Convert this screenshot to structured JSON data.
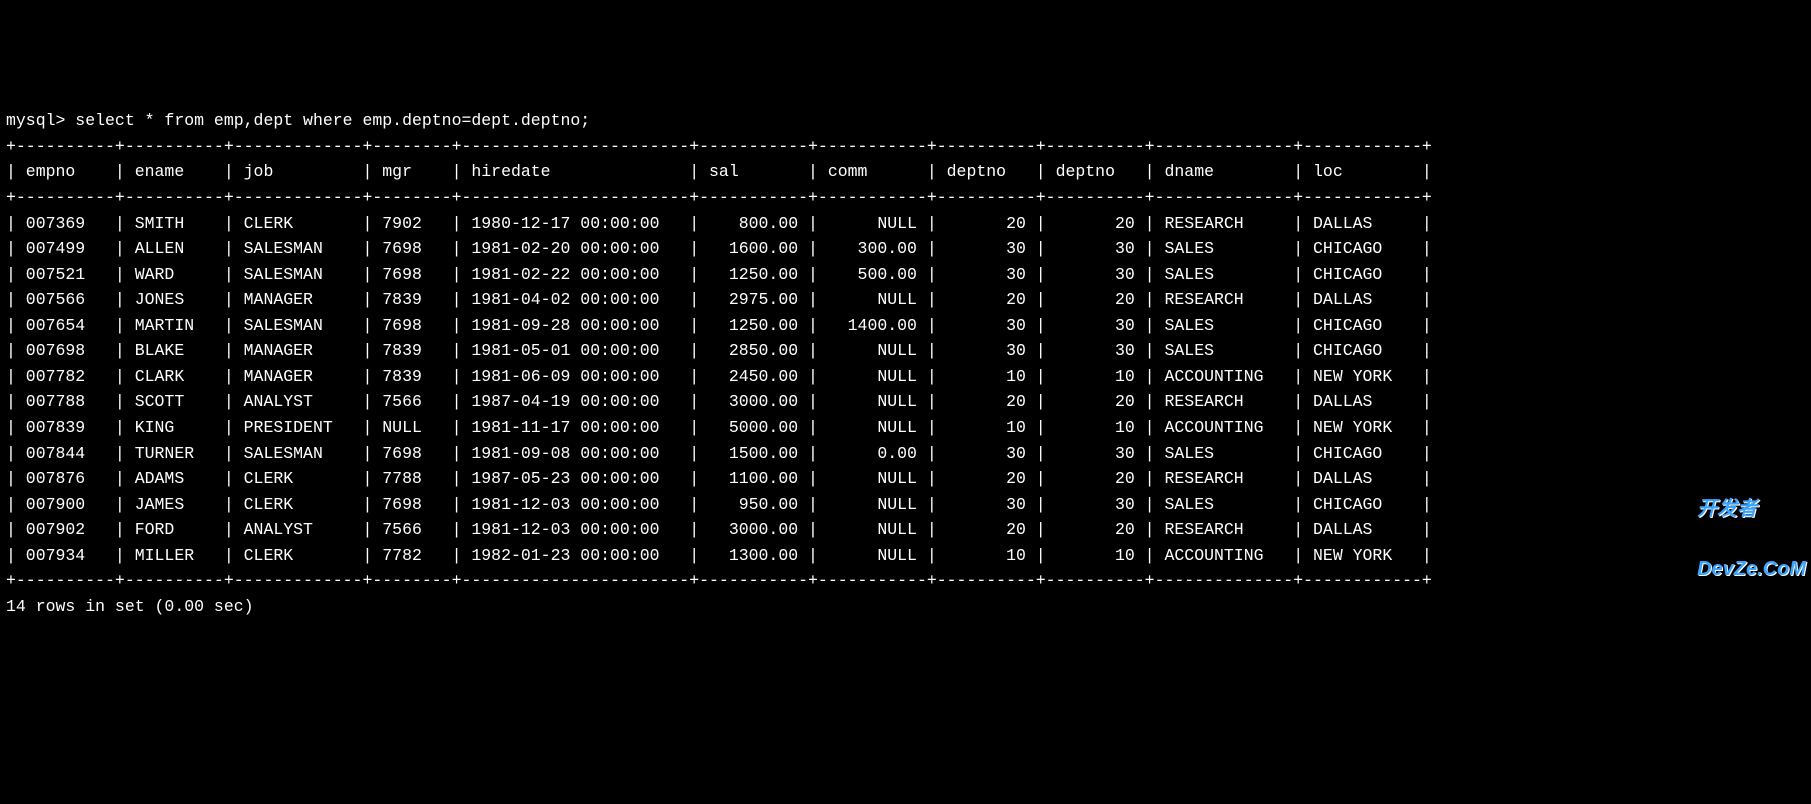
{
  "prompt": "mysql> ",
  "query": "select * from emp,dept where emp.deptno=dept.deptno;",
  "columns": [
    {
      "name": "empno",
      "width": 8,
      "align": "left"
    },
    {
      "name": "ename",
      "width": 8,
      "align": "left"
    },
    {
      "name": "job",
      "width": 11,
      "align": "left"
    },
    {
      "name": "mgr",
      "width": 6,
      "align": "left"
    },
    {
      "name": "hiredate",
      "width": 21,
      "align": "left"
    },
    {
      "name": "sal",
      "width": 9,
      "align": "right"
    },
    {
      "name": "comm",
      "width": 9,
      "align": "right"
    },
    {
      "name": "deptno",
      "width": 8,
      "align": "right"
    },
    {
      "name": "deptno",
      "width": 8,
      "align": "right"
    },
    {
      "name": "dname",
      "width": 12,
      "align": "left"
    },
    {
      "name": "loc",
      "width": 10,
      "align": "left"
    }
  ],
  "rows": [
    [
      "007369",
      "SMITH",
      "CLERK",
      "7902",
      "1980-12-17 00:00:00",
      "800.00",
      "NULL",
      "20",
      "20",
      "RESEARCH",
      "DALLAS"
    ],
    [
      "007499",
      "ALLEN",
      "SALESMAN",
      "7698",
      "1981-02-20 00:00:00",
      "1600.00",
      "300.00",
      "30",
      "30",
      "SALES",
      "CHICAGO"
    ],
    [
      "007521",
      "WARD",
      "SALESMAN",
      "7698",
      "1981-02-22 00:00:00",
      "1250.00",
      "500.00",
      "30",
      "30",
      "SALES",
      "CHICAGO"
    ],
    [
      "007566",
      "JONES",
      "MANAGER",
      "7839",
      "1981-04-02 00:00:00",
      "2975.00",
      "NULL",
      "20",
      "20",
      "RESEARCH",
      "DALLAS"
    ],
    [
      "007654",
      "MARTIN",
      "SALESMAN",
      "7698",
      "1981-09-28 00:00:00",
      "1250.00",
      "1400.00",
      "30",
      "30",
      "SALES",
      "CHICAGO"
    ],
    [
      "007698",
      "BLAKE",
      "MANAGER",
      "7839",
      "1981-05-01 00:00:00",
      "2850.00",
      "NULL",
      "30",
      "30",
      "SALES",
      "CHICAGO"
    ],
    [
      "007782",
      "CLARK",
      "MANAGER",
      "7839",
      "1981-06-09 00:00:00",
      "2450.00",
      "NULL",
      "10",
      "10",
      "ACCOUNTING",
      "NEW YORK"
    ],
    [
      "007788",
      "SCOTT",
      "ANALYST",
      "7566",
      "1987-04-19 00:00:00",
      "3000.00",
      "NULL",
      "20",
      "20",
      "RESEARCH",
      "DALLAS"
    ],
    [
      "007839",
      "KING",
      "PRESIDENT",
      "NULL",
      "1981-11-17 00:00:00",
      "5000.00",
      "NULL",
      "10",
      "10",
      "ACCOUNTING",
      "NEW YORK"
    ],
    [
      "007844",
      "TURNER",
      "SALESMAN",
      "7698",
      "1981-09-08 00:00:00",
      "1500.00",
      "0.00",
      "30",
      "30",
      "SALES",
      "CHICAGO"
    ],
    [
      "007876",
      "ADAMS",
      "CLERK",
      "7788",
      "1987-05-23 00:00:00",
      "1100.00",
      "NULL",
      "20",
      "20",
      "RESEARCH",
      "DALLAS"
    ],
    [
      "007900",
      "JAMES",
      "CLERK",
      "7698",
      "1981-12-03 00:00:00",
      "950.00",
      "NULL",
      "30",
      "30",
      "SALES",
      "CHICAGO"
    ],
    [
      "007902",
      "FORD",
      "ANALYST",
      "7566",
      "1981-12-03 00:00:00",
      "3000.00",
      "NULL",
      "20",
      "20",
      "RESEARCH",
      "DALLAS"
    ],
    [
      "007934",
      "MILLER",
      "CLERK",
      "7782",
      "1982-01-23 00:00:00",
      "1300.00",
      "NULL",
      "10",
      "10",
      "ACCOUNTING",
      "NEW YORK"
    ]
  ],
  "footer": "14 rows in set (0.00 sec)",
  "watermark_line1": "开发者",
  "watermark_line2": "DevZe.CoM"
}
